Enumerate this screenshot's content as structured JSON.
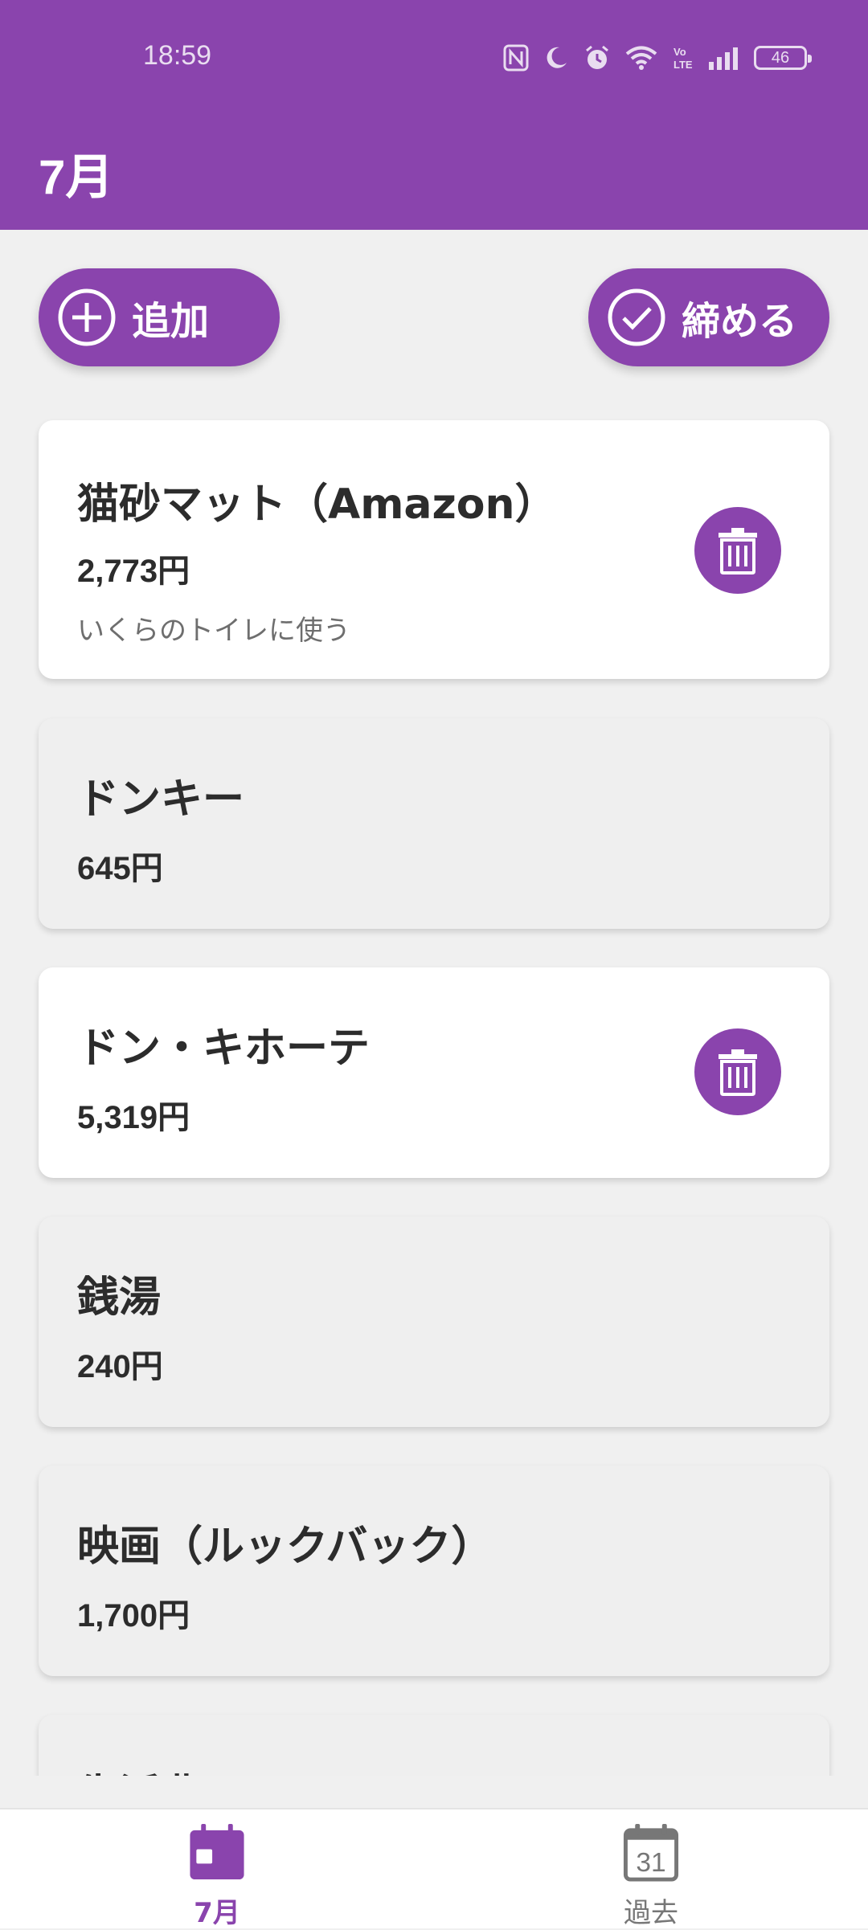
{
  "status_bar": {
    "time": "18:59",
    "battery": "46",
    "icons": [
      "nfc-icon",
      "moon-icon",
      "alarm-icon",
      "wifi-icon",
      "volte-icon",
      "signal-icon",
      "battery-icon"
    ]
  },
  "header": {
    "title": "7月"
  },
  "actions": {
    "add_label": "追加",
    "close_label": "締める"
  },
  "expenses": [
    {
      "name": "猫砂マット（Amazon）",
      "price": "2,773円",
      "note": "いくらのトイレに使う",
      "deletable": true
    },
    {
      "name": "ドンキー",
      "price": "645円",
      "note": "",
      "deletable": false
    },
    {
      "name": "ドン・キホーテ",
      "price": "5,319円",
      "note": "",
      "deletable": true
    },
    {
      "name": "銭湯",
      "price": "240円",
      "note": "",
      "deletable": false
    },
    {
      "name": "映画（ルックバック）",
      "price": "1,700円",
      "note": "",
      "deletable": false
    },
    {
      "name": "生活費",
      "price": "",
      "note": "",
      "deletable": false
    }
  ],
  "bottom_nav": {
    "items": [
      {
        "label": "7月",
        "icon": "calendar-icon",
        "active": true
      },
      {
        "label": "過去",
        "icon": "calendar-31-icon",
        "calendar_number": "31",
        "active": false
      }
    ]
  },
  "colors": {
    "primary": "#8a44ad",
    "background": "#f0f0f0"
  }
}
